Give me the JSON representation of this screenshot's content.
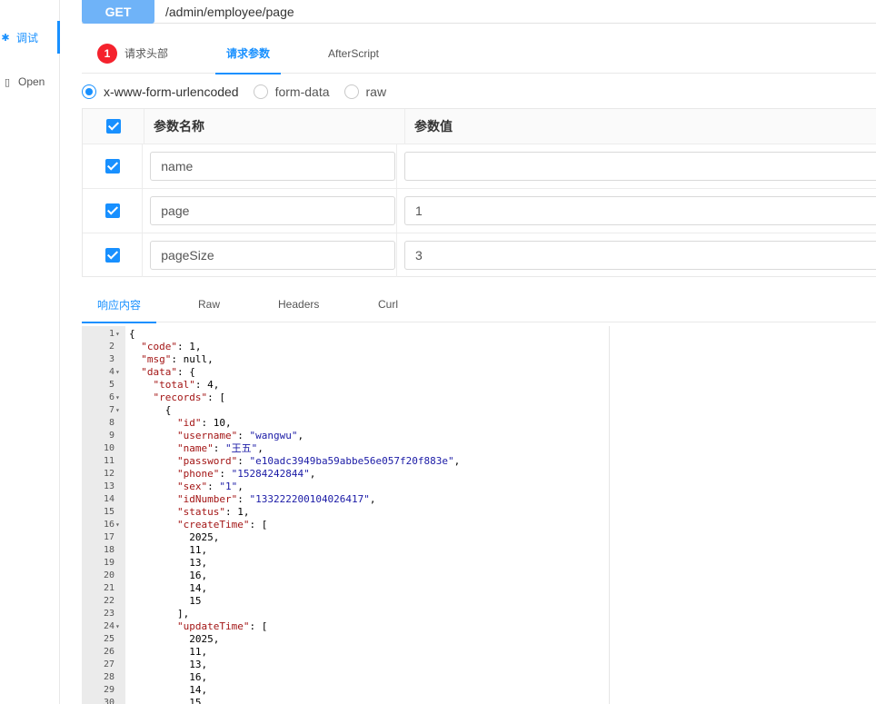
{
  "sidebar": {
    "items": [
      {
        "label": "调试",
        "icon": "bug-icon",
        "active": true
      },
      {
        "label": "Open",
        "icon": "document-icon",
        "active": false
      }
    ]
  },
  "request": {
    "method": "GET",
    "url": "/admin/employee/page"
  },
  "request_tabs": {
    "badge": "1",
    "items": [
      "请求头部",
      "请求参数",
      "AfterScript"
    ],
    "active": "请求参数"
  },
  "body_types": {
    "options": [
      "x-www-form-urlencoded",
      "form-data",
      "raw"
    ],
    "selected": "x-www-form-urlencoded"
  },
  "params_table": {
    "headers": [
      "参数名称",
      "参数值"
    ],
    "rows": [
      {
        "checked": true,
        "name": "name",
        "value": ""
      },
      {
        "checked": true,
        "name": "page",
        "value": "1"
      },
      {
        "checked": true,
        "name": "pageSize",
        "value": "3"
      }
    ]
  },
  "response_tabs": {
    "items": [
      "响应内容",
      "Raw",
      "Headers",
      "Curl"
    ],
    "active": "响应内容"
  },
  "response_lines": [
    {
      "n": "1",
      "fold": true,
      "text": "{"
    },
    {
      "n": "2",
      "fold": false,
      "text": "  \"code\": 1,"
    },
    {
      "n": "3",
      "fold": false,
      "text": "  \"msg\": null,"
    },
    {
      "n": "4",
      "fold": true,
      "text": "  \"data\": {"
    },
    {
      "n": "5",
      "fold": false,
      "text": "    \"total\": 4,"
    },
    {
      "n": "6",
      "fold": true,
      "text": "    \"records\": ["
    },
    {
      "n": "7",
      "fold": true,
      "text": "      {"
    },
    {
      "n": "8",
      "fold": false,
      "text": "        \"id\": 10,"
    },
    {
      "n": "9",
      "fold": false,
      "text": "        \"username\": \"wangwu\","
    },
    {
      "n": "10",
      "fold": false,
      "text": "        \"name\": \"王五\","
    },
    {
      "n": "11",
      "fold": false,
      "text": "        \"password\": \"e10adc3949ba59abbe56e057f20f883e\","
    },
    {
      "n": "12",
      "fold": false,
      "text": "        \"phone\": \"15284242844\","
    },
    {
      "n": "13",
      "fold": false,
      "text": "        \"sex\": \"1\","
    },
    {
      "n": "14",
      "fold": false,
      "text": "        \"idNumber\": \"133222200104026417\","
    },
    {
      "n": "15",
      "fold": false,
      "text": "        \"status\": 1,"
    },
    {
      "n": "16",
      "fold": true,
      "text": "        \"createTime\": ["
    },
    {
      "n": "17",
      "fold": false,
      "text": "          2025,"
    },
    {
      "n": "18",
      "fold": false,
      "text": "          11,"
    },
    {
      "n": "19",
      "fold": false,
      "text": "          13,"
    },
    {
      "n": "20",
      "fold": false,
      "text": "          16,"
    },
    {
      "n": "21",
      "fold": false,
      "text": "          14,"
    },
    {
      "n": "22",
      "fold": false,
      "text": "          15"
    },
    {
      "n": "23",
      "fold": false,
      "text": "        ],"
    },
    {
      "n": "24",
      "fold": true,
      "text": "        \"updateTime\": ["
    },
    {
      "n": "25",
      "fold": false,
      "text": "          2025,"
    },
    {
      "n": "26",
      "fold": false,
      "text": "          11,"
    },
    {
      "n": "27",
      "fold": false,
      "text": "          13,"
    },
    {
      "n": "28",
      "fold": false,
      "text": "          16,"
    },
    {
      "n": "29",
      "fold": false,
      "text": "          14,"
    },
    {
      "n": "30",
      "fold": false,
      "text": "          15"
    }
  ],
  "colors": {
    "accent": "#1890ff",
    "method_bg": "#6fb3f8",
    "badge": "#f5222d",
    "json_key": "#a31515",
    "json_string": "#1a1aa6"
  }
}
